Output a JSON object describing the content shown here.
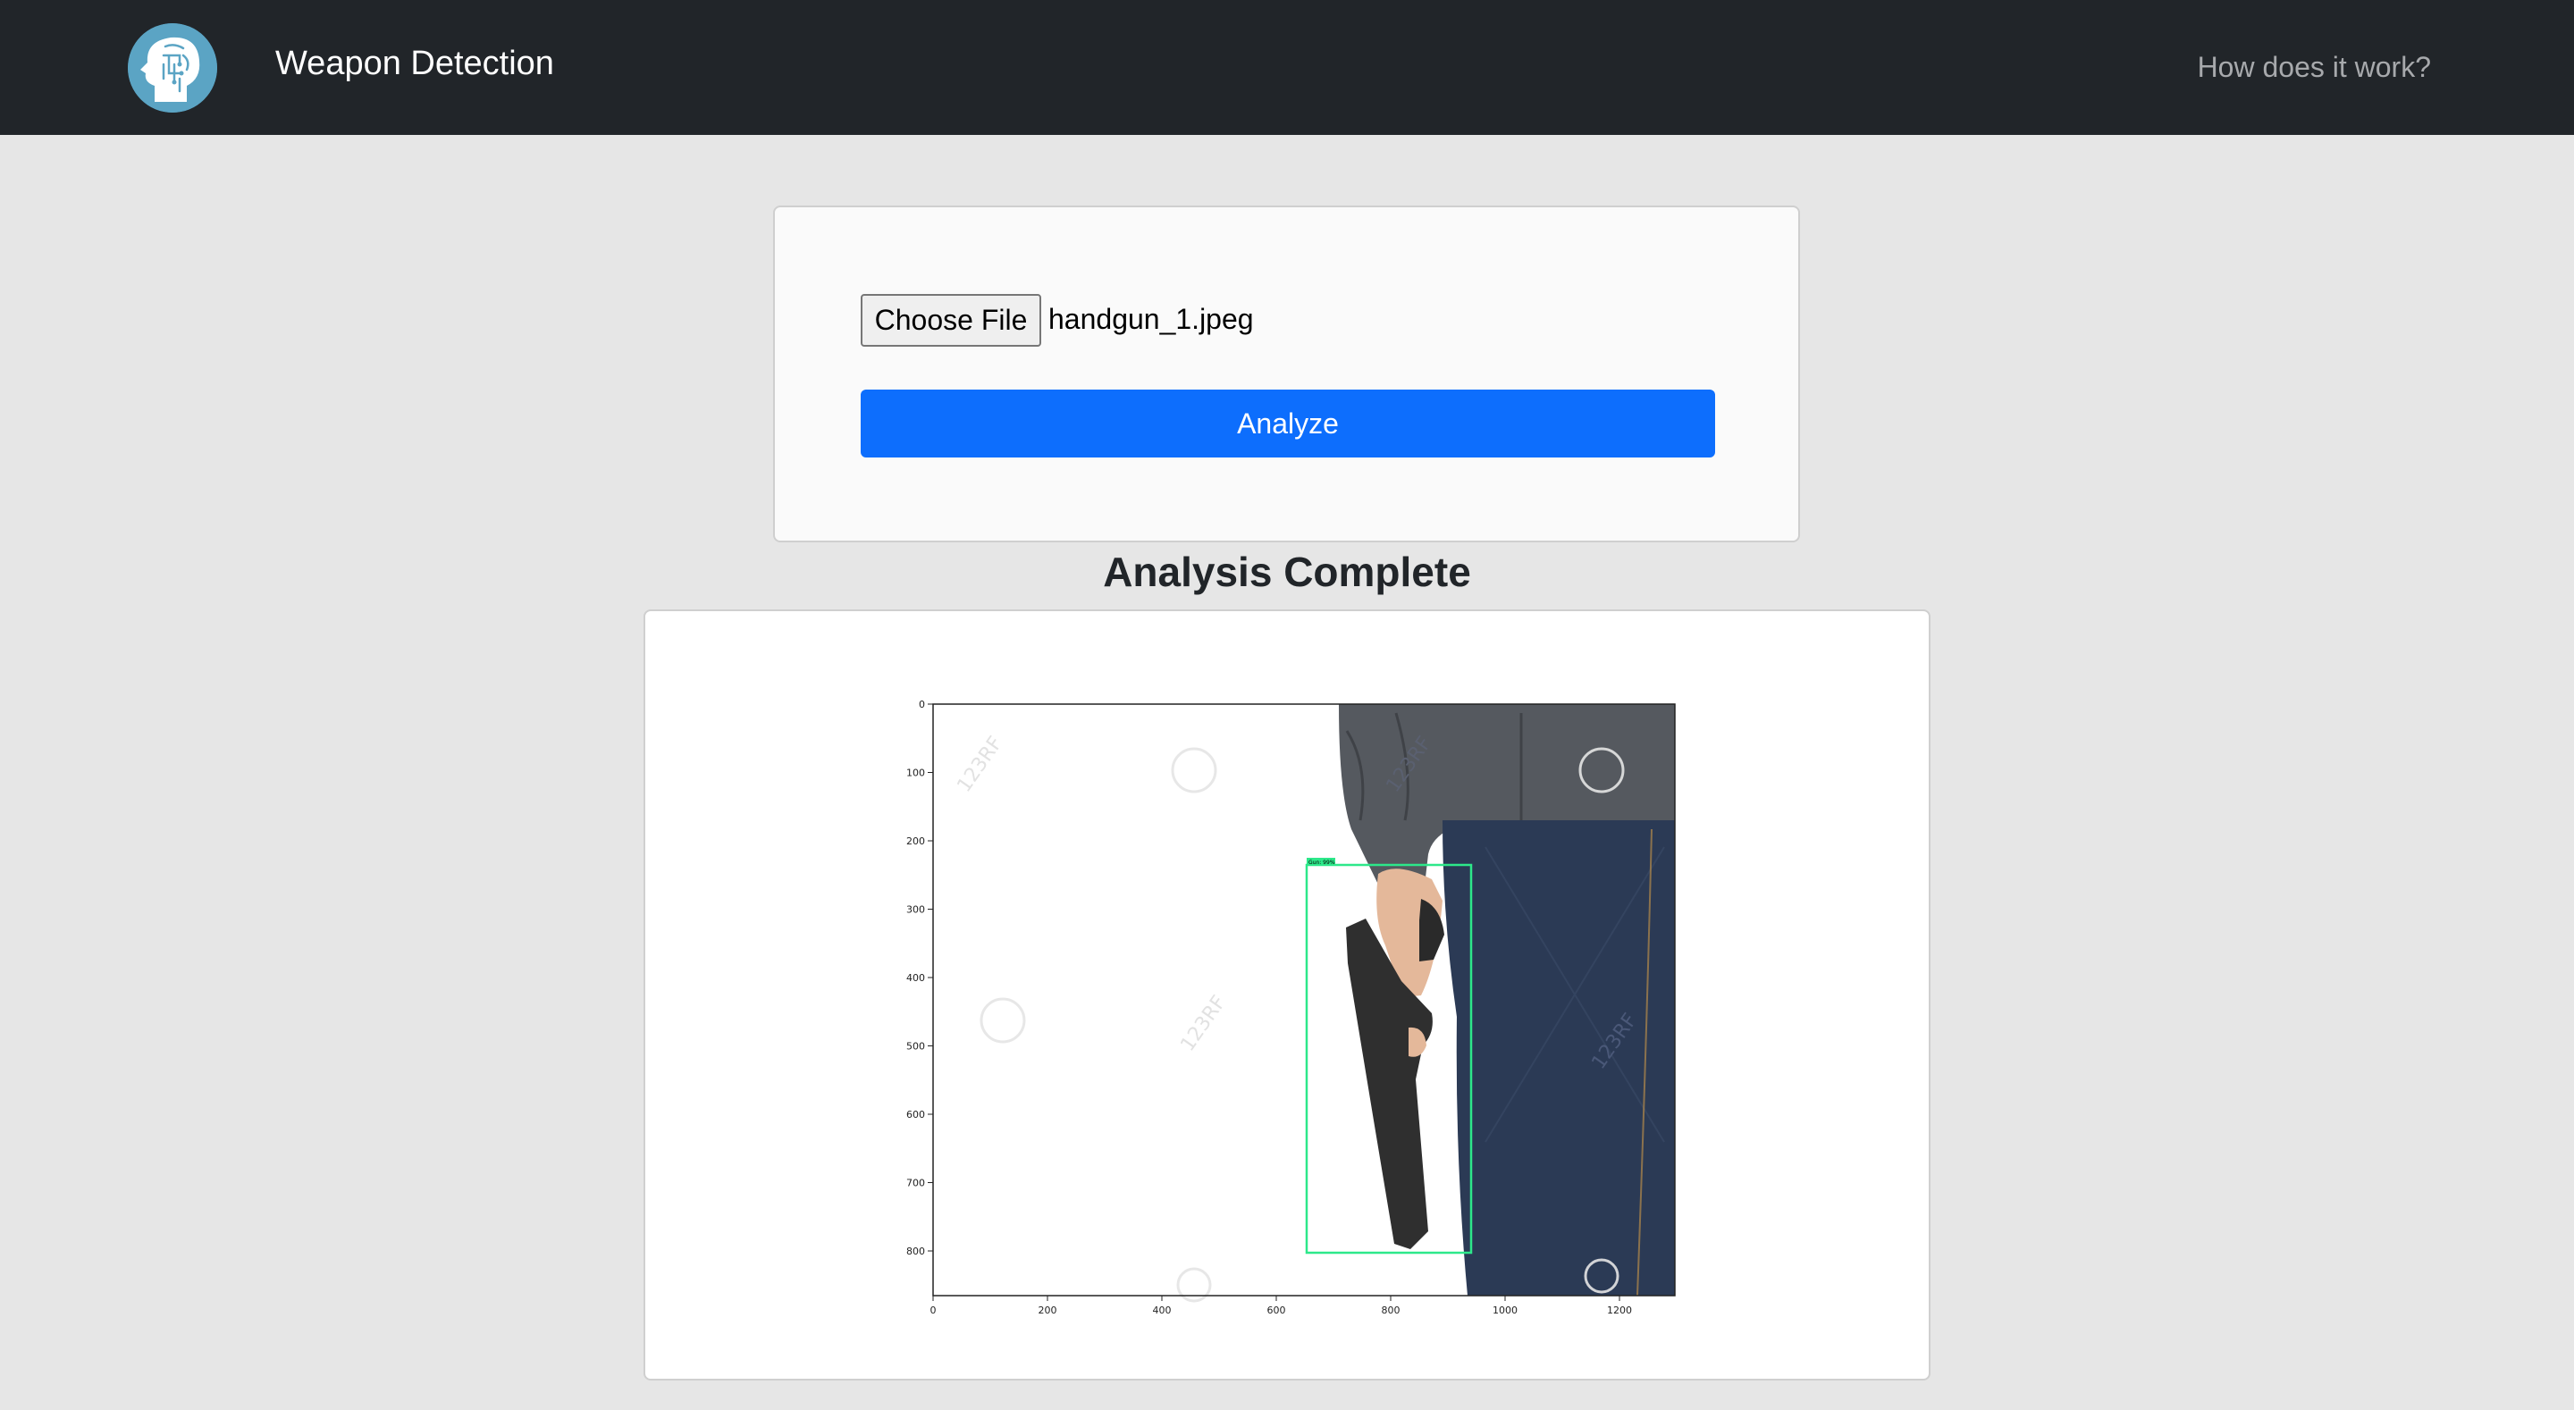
{
  "navbar": {
    "brand": "Weapon Detection",
    "link": "How does it work?",
    "logo_icon": "brain-head-logo-icon",
    "background": "#212529"
  },
  "upload": {
    "choose_file_label": "Choose File",
    "file_name": "handgun_1.jpeg",
    "analyze_label": "Analyze",
    "accent": "#0d6efd"
  },
  "result": {
    "heading": "Analysis Complete",
    "figure": {
      "x_ticks": [
        "0",
        "200",
        "400",
        "600",
        "800",
        "1000",
        "1200"
      ],
      "y_ticks": [
        "0",
        "100",
        "200",
        "300",
        "400",
        "500",
        "600",
        "700",
        "800"
      ],
      "detection_label": "Gun: 99%",
      "detection_box_color": "#2de88a",
      "watermark": "123RF"
    }
  }
}
